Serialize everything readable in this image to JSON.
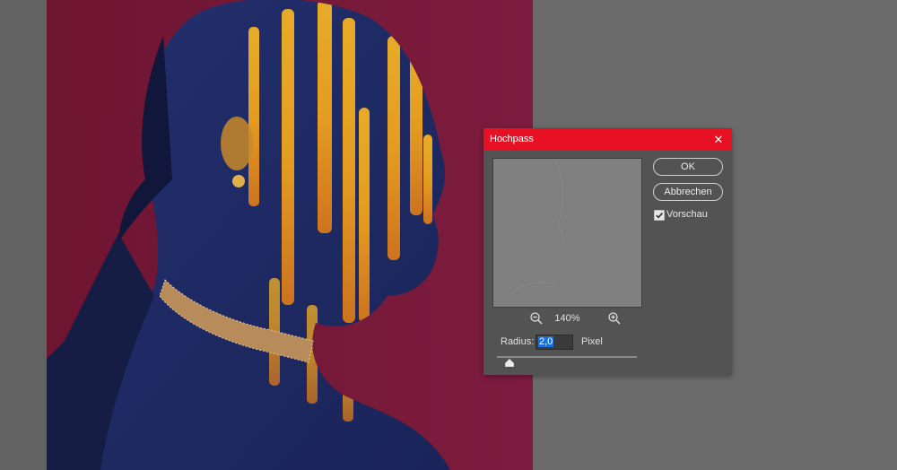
{
  "dialog": {
    "title": "Hochpass",
    "ok_label": "OK",
    "cancel_label": "Abbrechen",
    "preview_label": "Vorschau",
    "preview_checked": true,
    "zoom_level": "140%",
    "radius_label": "Radius:",
    "radius_value": "2,0",
    "radius_unit": "Pixel",
    "slider_value_fraction": 0.09,
    "accent_color": "#e81123"
  },
  "canvas": {
    "background_color": "#7a1a3a"
  }
}
